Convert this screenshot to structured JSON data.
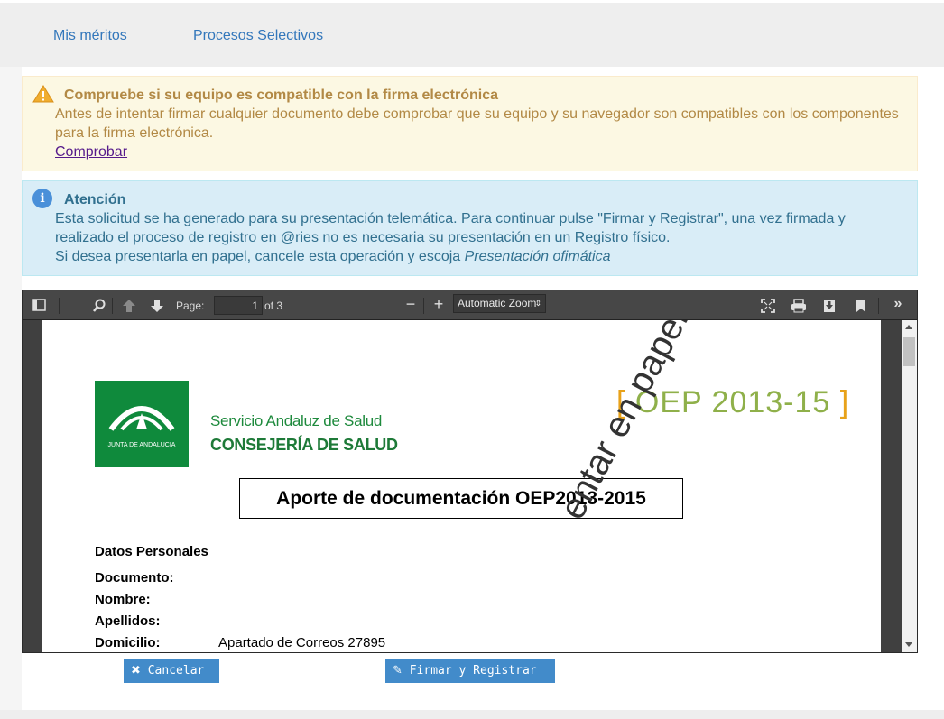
{
  "nav": {
    "item1": "Mis méritos",
    "item2": "Procesos Selectivos"
  },
  "warning": {
    "title": "Compruebe si su equipo es compatible con la firma electrónica",
    "body": "Antes de intentar firmar cualquier documento debe comprobar que su equipo y su navegador son compatibles con los componentes para la firma electrónica.",
    "link": "Comprobar",
    "icon": "warning-triangle-icon"
  },
  "info": {
    "title": "Atención",
    "line1": "Esta solicitud se ha generado para su presentación telemática. Para continuar pulse \"Firmar y Registrar\", una vez firmada y realizado el proceso de registro en @ries no es necesaria su presentación en un Registro físico.",
    "line2_prefix": "Si desea presentarla en papel, cancele esta operación y escoja ",
    "line2_em": "Presentación ofimática",
    "icon": "info-icon"
  },
  "viewer": {
    "page_label": "Page:",
    "page_value": "1",
    "page_total": "of 3",
    "zoom": "Automatic Zoom"
  },
  "document": {
    "org_line1": "Servicio Andaluz de Salud",
    "org_line2": "CONSEJERÍA DE SALUD",
    "logo_text": "JUNTA DE ANDALUCIA",
    "oep_open": "[",
    "oep_text": "OEP 2013-15",
    "oep_close": "]",
    "title": "Aporte de documentación OEP2013-2015",
    "section": "Datos Personales",
    "fields": [
      {
        "label": "Documento:",
        "value": ""
      },
      {
        "label": "Nombre:",
        "value": ""
      },
      {
        "label": "Apellidos:",
        "value": ""
      },
      {
        "label": "Domicilio:",
        "value": "Apartado de Correos 27895"
      }
    ],
    "watermark": "entar en papel."
  },
  "actions": {
    "cancel": "Cancelar",
    "sign": "Firmar y Registrar"
  },
  "colors": {
    "accent": "#428bca",
    "warning_bg": "#fcf8e3",
    "info_bg": "#d9edf7"
  }
}
